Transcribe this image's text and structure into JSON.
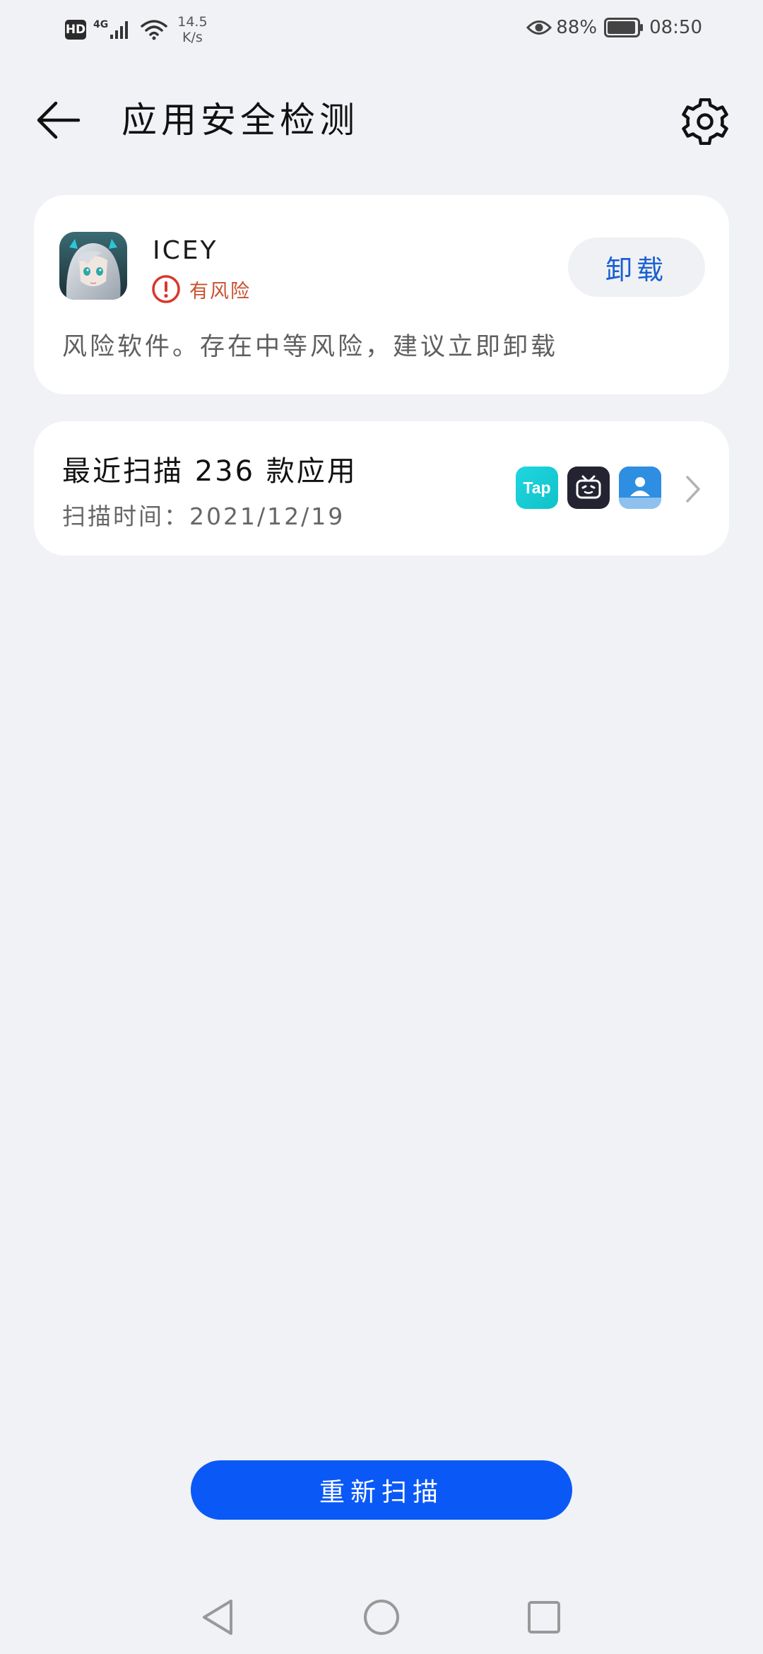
{
  "status_bar": {
    "hd_label": "HD",
    "network_type": "4G",
    "speed_value": "14.5",
    "speed_unit": "K/s",
    "battery_percent": "88%",
    "time": "08:50"
  },
  "header": {
    "title": "应用安全检测"
  },
  "risk_card": {
    "app_name": "ICEY",
    "risk_level": "有风险",
    "uninstall_label": "卸载",
    "description": "风险软件。存在中等风险，建议立即卸载"
  },
  "scan_card": {
    "title": "最近扫描 236 款应用",
    "time_label": "扫描时间：",
    "time_value": "2021/12/19",
    "recent_apps": [
      {
        "name": "Tap",
        "icon": "taptap-icon"
      },
      {
        "name": "",
        "icon": "bilibili-icon"
      },
      {
        "name": "",
        "icon": "contacts-icon"
      }
    ]
  },
  "rescan_label": "重新扫描",
  "colors": {
    "accent": "#0a59f7",
    "risk": "#d9362b",
    "risk_text": "#c9502f",
    "background": "#f1f2f5"
  }
}
